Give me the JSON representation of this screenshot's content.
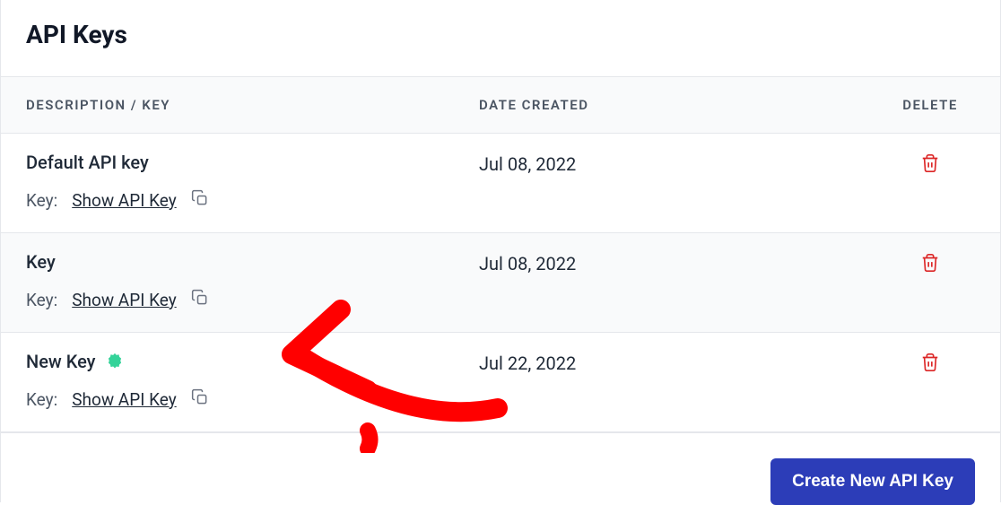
{
  "header": {
    "title": "API Keys"
  },
  "table": {
    "columns": {
      "description": "DESCRIPTION / KEY",
      "date": "DATE CREATED",
      "delete": "DELETE"
    },
    "key_label": "Key:",
    "show_link": "Show API Key",
    "rows": [
      {
        "title": "Default API key",
        "date": "Jul 08, 2022",
        "is_new": false
      },
      {
        "title": "Key",
        "date": "Jul 08, 2022",
        "is_new": false
      },
      {
        "title": "New Key",
        "date": "Jul 22, 2022",
        "is_new": true
      }
    ]
  },
  "footer": {
    "create_button": "Create New API Key"
  }
}
